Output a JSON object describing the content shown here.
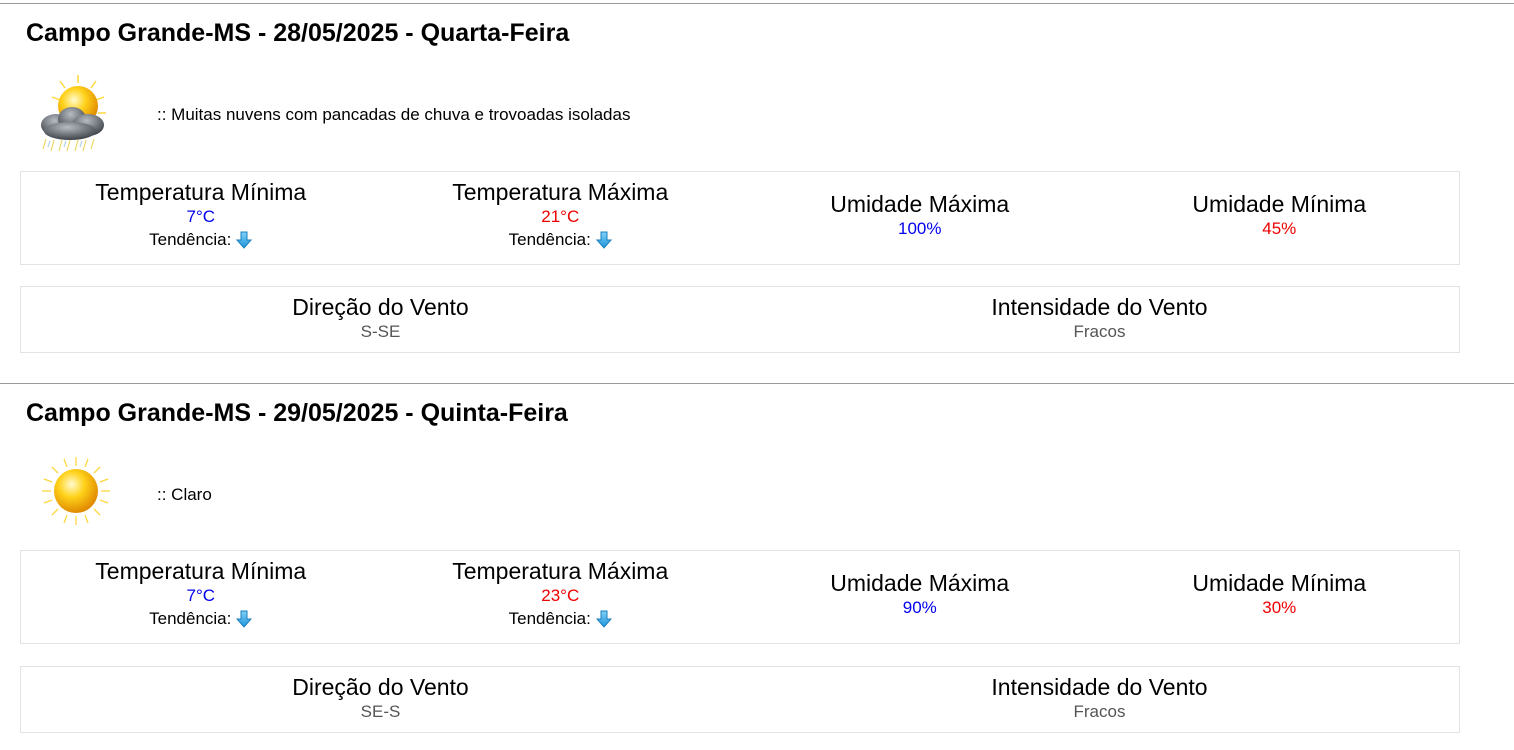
{
  "colors": {
    "min_value": "#0000ee",
    "max_value": "#ee0000",
    "wind_value": "#555555",
    "divider": "#9a9a9a",
    "box_border": "#e3e3e3",
    "trend_arrow": "#2aa7e8"
  },
  "days": [
    {
      "title": "Campo Grande-MS - 28/05/2025 - Quarta-Feira",
      "icon": "sun-cloud-storm-icon",
      "condition": ":: Muitas nuvens com pancadas de chuva e trovoadas isoladas",
      "temp_min": {
        "label": "Temperatura Mínima",
        "value": "7°C",
        "trend_label": "Tendência:",
        "trend_icon": "arrow-down-icon"
      },
      "temp_max": {
        "label": "Temperatura Máxima",
        "value": "21°C",
        "trend_label": "Tendência:",
        "trend_icon": "arrow-down-icon"
      },
      "humidity_max": {
        "label": "Umidade Máxima",
        "value": "100%"
      },
      "humidity_min": {
        "label": "Umidade Mínima",
        "value": "45%"
      },
      "wind_direction": {
        "label": "Direção do Vento",
        "value": "S-SE"
      },
      "wind_intensity": {
        "label": "Intensidade do Vento",
        "value": "Fracos"
      }
    },
    {
      "title": "Campo Grande-MS - 29/05/2025 - Quinta-Feira",
      "icon": "sun-icon",
      "condition": ":: Claro",
      "temp_min": {
        "label": "Temperatura Mínima",
        "value": "7°C",
        "trend_label": "Tendência:",
        "trend_icon": "arrow-down-icon"
      },
      "temp_max": {
        "label": "Temperatura Máxima",
        "value": "23°C",
        "trend_label": "Tendência:",
        "trend_icon": "arrow-down-icon"
      },
      "humidity_max": {
        "label": "Umidade Máxima",
        "value": "90%"
      },
      "humidity_min": {
        "label": "Umidade Mínima",
        "value": "30%"
      },
      "wind_direction": {
        "label": "Direção do Vento",
        "value": "SE-S"
      },
      "wind_intensity": {
        "label": "Intensidade do Vento",
        "value": "Fracos"
      }
    }
  ]
}
